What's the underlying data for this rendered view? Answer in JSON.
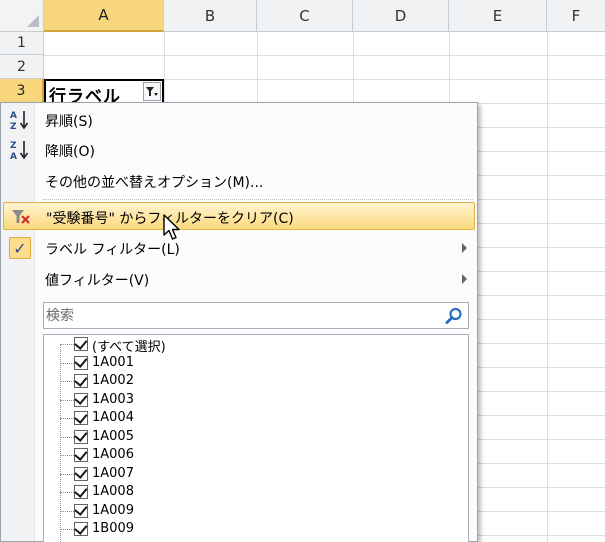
{
  "sheet": {
    "columns": [
      "A",
      "B",
      "C",
      "D",
      "E",
      "F"
    ],
    "active_column": "A",
    "rows": [
      "1",
      "2",
      "3"
    ],
    "active_row": "3",
    "cell_a3_label": "行ラベル"
  },
  "menu": {
    "sort_asc": "昇順(S)",
    "sort_desc": "降順(O)",
    "more_sort": "その他の並べ替えオプション(M)...",
    "clear_filter": "\"受験番号\" からフィルターをクリア(C)",
    "label_filter": "ラベル フィルター(L)",
    "value_filter": "値フィルター(V)",
    "search_placeholder": "検索",
    "items": [
      "(すべて選択)",
      "1A001",
      "1A002",
      "1A003",
      "1A004",
      "1A005",
      "1A006",
      "1A007",
      "1A008",
      "1A009",
      "1B009"
    ]
  },
  "colors": {
    "active_header": "#f8d67e",
    "highlight": "#fcd97b",
    "accent_blue": "#2b4d8a"
  },
  "icons": {
    "sort_asc": "sort-a-z-icon",
    "sort_desc": "sort-z-a-icon",
    "clear_filter": "clear-filter-icon",
    "checked": "checkmark-icon",
    "search": "search-icon",
    "dropdown": "filter-dropdown-icon"
  }
}
